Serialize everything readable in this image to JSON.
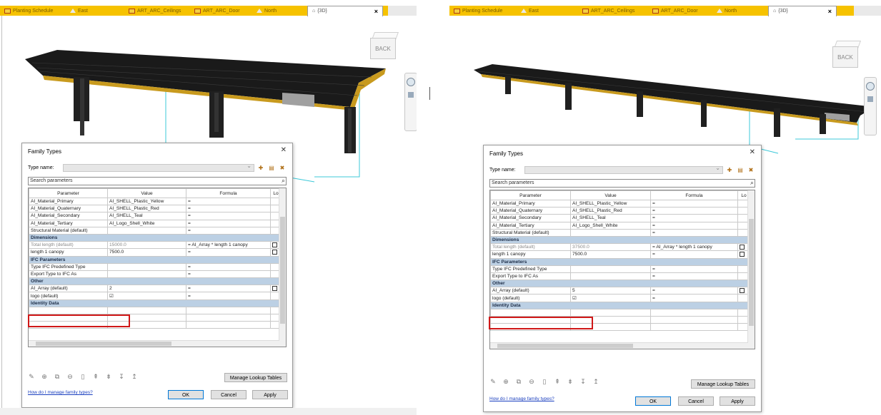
{
  "tabs": [
    {
      "label": "Planting Schedule",
      "icon": "schedule-icon"
    },
    {
      "label": "East",
      "icon": "elevation-icon"
    },
    {
      "label": "ART_ARC_Ceilings",
      "icon": "schedule-icon"
    },
    {
      "label": "ART_ARC_Door",
      "icon": "schedule-icon"
    },
    {
      "label": "North",
      "icon": "elevation-icon"
    },
    {
      "label": "{3D}",
      "icon": "3d-view-icon"
    }
  ],
  "close_label": "×",
  "viewcube_label": "BACK",
  "dialog": {
    "title": "Family Types",
    "close": "✕",
    "type_name_label": "Type name:",
    "search_placeholder": "Search parameters",
    "columns": [
      "Parameter",
      "Value",
      "Formula",
      "Lo"
    ],
    "manage_lookup": "Manage Lookup Tables",
    "help_link": "How do I manage family types?",
    "ok": "OK",
    "cancel": "Cancel",
    "apply": "Apply"
  },
  "left": {
    "rows": [
      {
        "kind": "param",
        "name": "AI_Material_Primary",
        "value": "AI_SHELL_Plastic_Yellow",
        "formula": "="
      },
      {
        "kind": "param",
        "name": "AI_Material_Quaternary",
        "value": "AI_SHELL_Plastic_Red",
        "formula": "="
      },
      {
        "kind": "param",
        "name": "AI_Material_Secondary",
        "value": "AI_SHELL_Teal",
        "formula": "="
      },
      {
        "kind": "param",
        "name": "AI_Material_Tertiary",
        "value": "AI_Logo_Shell_White",
        "formula": "="
      },
      {
        "kind": "param",
        "name": "Structural Material (default)",
        "value": "",
        "formula": "="
      },
      {
        "kind": "group",
        "name": "Dimensions"
      },
      {
        "kind": "muted",
        "name": "Total length (default)",
        "value": "15000.0",
        "formula": "= AI_Array * length 1 canopy",
        "lock": true
      },
      {
        "kind": "param",
        "name": "length 1 canopy",
        "value": "7500.0",
        "formula": "=",
        "lock": true
      },
      {
        "kind": "group",
        "name": "IFC Parameters"
      },
      {
        "kind": "param",
        "name": "Type IFC Predefined Type",
        "value": "",
        "formula": "="
      },
      {
        "kind": "param",
        "name": "Export Type to IFC As",
        "value": "",
        "formula": "="
      },
      {
        "kind": "group",
        "name": "Other"
      },
      {
        "kind": "param",
        "name": "AI_Array (default)",
        "value": "2",
        "formula": "=",
        "lock": true
      },
      {
        "kind": "param",
        "name": "logo (default)",
        "value": "☑",
        "formula": "="
      },
      {
        "kind": "group",
        "name": "Identity Data"
      }
    ]
  },
  "right": {
    "rows": [
      {
        "kind": "param",
        "name": "AI_Material_Primary",
        "value": "AI_SHELL_Plastic_Yellow",
        "formula": "="
      },
      {
        "kind": "param",
        "name": "AI_Material_Quaternary",
        "value": "AI_SHELL_Plastic_Red",
        "formula": "="
      },
      {
        "kind": "param",
        "name": "AI_Material_Secondary",
        "value": "AI_SHELL_Teal",
        "formula": "="
      },
      {
        "kind": "param",
        "name": "AI_Material_Tertiary",
        "value": "AI_Logo_Shell_White",
        "formula": "="
      },
      {
        "kind": "param",
        "name": "Structural Material (default)",
        "value": "",
        "formula": "="
      },
      {
        "kind": "group",
        "name": "Dimensions"
      },
      {
        "kind": "muted",
        "name": "Total length (default)",
        "value": "37500.0",
        "formula": "= AI_Array * length 1 canopy",
        "lock": true
      },
      {
        "kind": "param",
        "name": "length 1 canopy",
        "value": "7500.0",
        "formula": "=",
        "lock": true
      },
      {
        "kind": "group",
        "name": "IFC Parameters"
      },
      {
        "kind": "param",
        "name": "Type IFC Predefined Type",
        "value": "",
        "formula": "="
      },
      {
        "kind": "param",
        "name": "Export Type to IFC As",
        "value": "",
        "formula": "="
      },
      {
        "kind": "group",
        "name": "Other"
      },
      {
        "kind": "param",
        "name": "AI_Array (default)",
        "value": "5",
        "formula": "=",
        "lock": true
      },
      {
        "kind": "param",
        "name": "logo (default)",
        "value": "☑",
        "formula": "="
      },
      {
        "kind": "group",
        "name": "Identity Data"
      }
    ]
  },
  "colors": {
    "tab_bar": "#f6c200",
    "highlight": "#d01818",
    "group_row": "#bcd0e4",
    "canopy": "#c89a1e",
    "selection": "#3cc8d8"
  }
}
